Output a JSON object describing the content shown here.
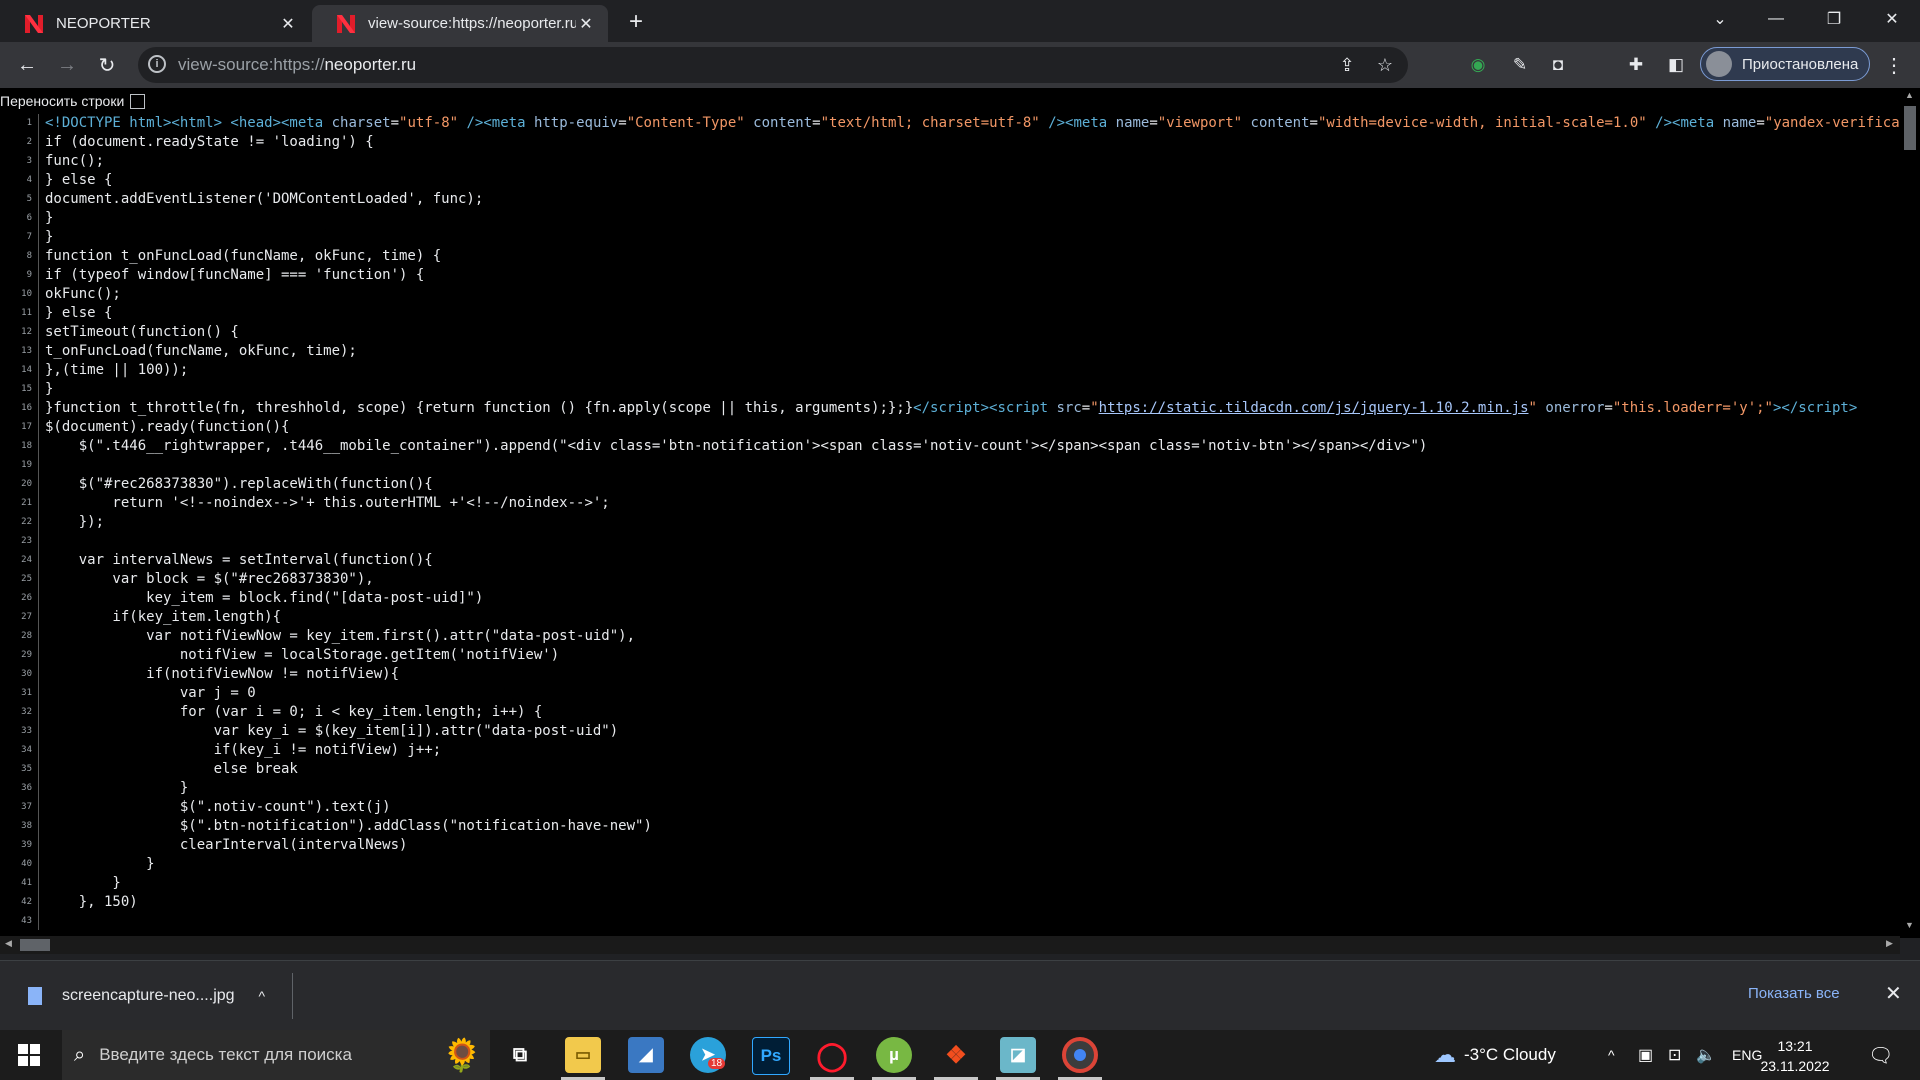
{
  "tabs": [
    {
      "title": "NEOPORTER",
      "active": false
    },
    {
      "title": "view-source:https://neoporter.ru",
      "active": true
    }
  ],
  "omnibox": {
    "url_prefix": "view-source:https://",
    "url_host": "neoporter.ru"
  },
  "profile": {
    "label": "Приостановлена"
  },
  "source": {
    "wrap_label": "Переносить строки",
    "lines": [
      {
        "n": "1",
        "html": "<span class='tg'>&lt;!DOCTYPE html&gt;&lt;html&gt; &lt;head&gt;&lt;meta</span> <span class='at'>charset</span>=<span class='av2'>\"utf-8\"</span> <span class='tg'>/&gt;&lt;meta</span> <span class='at'>http-equiv</span>=<span class='av2'>\"Content-Type\"</span> <span class='at'>content</span>=<span class='av2'>\"text/html; charset=utf-8\"</span> <span class='tg'>/&gt;&lt;meta</span> <span class='at'>name</span>=<span class='av2'>\"viewport\"</span> <span class='at'>content</span>=<span class='av2'>\"width=device-width, initial-scale=1.0\"</span> <span class='tg'>/&gt;&lt;meta</span> <span class='at'>name</span>=<span class='av2'>\"yandex-verification\"</span>"
      },
      {
        "n": "2",
        "html": "if (document.readyState != 'loading') {"
      },
      {
        "n": "3",
        "html": "func();"
      },
      {
        "n": "4",
        "html": "} else {"
      },
      {
        "n": "5",
        "html": "document.addEventListener('DOMContentLoaded', func);"
      },
      {
        "n": "6",
        "html": "}"
      },
      {
        "n": "7",
        "html": "}"
      },
      {
        "n": "8",
        "html": "function t_onFuncLoad(funcName, okFunc, time) {"
      },
      {
        "n": "9",
        "html": "if (typeof window[funcName] === 'function') {"
      },
      {
        "n": "10",
        "html": "okFunc();"
      },
      {
        "n": "11",
        "html": "} else {"
      },
      {
        "n": "12",
        "html": "setTimeout(function() {"
      },
      {
        "n": "13",
        "html": "t_onFuncLoad(funcName, okFunc, time);"
      },
      {
        "n": "14",
        "html": "},(time || 100));"
      },
      {
        "n": "15",
        "html": "}"
      },
      {
        "n": "16",
        "html": "}function t_throttle(fn, threshhold, scope) {return function () {fn.apply(scope || this, arguments);};}<span class='tg'>&lt;/script&gt;&lt;script</span> <span class='at'>src</span>=<span class='av2'>\"</span><span class='lk'>https://static.tildacdn.com/js/jquery-1.10.2.min.js</span><span class='av2'>\"</span> <span class='at'>onerror</span>=<span class='av2'>\"this.loaderr='y';\"</span><span class='tg'>&gt;&lt;/script&gt;</span>"
      },
      {
        "n": "17",
        "html": "$(document).ready(function(){"
      },
      {
        "n": "18",
        "html": "    $(\".t446__rightwrapper, .t446__mobile_container\").append(\"&lt;div class='btn-notification'&gt;&lt;span class='notiv-count'&gt;&lt;/span&gt;&lt;span class='notiv-btn'&gt;&lt;/span&gt;&lt;/div&gt;\")"
      },
      {
        "n": "19",
        "html": ""
      },
      {
        "n": "20",
        "html": "    $(\"#rec268373830\").replaceWith(function(){"
      },
      {
        "n": "21",
        "html": "        return '&lt;!--noindex--&gt;'+ this.outerHTML +'&lt;!--/noindex--&gt;';"
      },
      {
        "n": "22",
        "html": "    });"
      },
      {
        "n": "23",
        "html": ""
      },
      {
        "n": "24",
        "html": "    var intervalNews = setInterval(function(){"
      },
      {
        "n": "25",
        "html": "        var block = $(\"#rec268373830\"),"
      },
      {
        "n": "26",
        "html": "            key_item = block.find(\"[data-post-uid]\")"
      },
      {
        "n": "27",
        "html": "        if(key_item.length){"
      },
      {
        "n": "28",
        "html": "            var notifViewNow = key_item.first().attr(\"data-post-uid\"),"
      },
      {
        "n": "29",
        "html": "                notifView = localStorage.getItem('notifView')"
      },
      {
        "n": "30",
        "html": "            if(notifViewNow != notifView){"
      },
      {
        "n": "31",
        "html": "                var j = 0"
      },
      {
        "n": "32",
        "html": "                for (var i = 0; i &lt; key_item.length; i++) {"
      },
      {
        "n": "33",
        "html": "                    var key_i = $(key_item[i]).attr(\"data-post-uid\")"
      },
      {
        "n": "34",
        "html": "                    if(key_i != notifView) j++;"
      },
      {
        "n": "35",
        "html": "                    else break"
      },
      {
        "n": "36",
        "html": "                }"
      },
      {
        "n": "37",
        "html": "                $(\".notiv-count\").text(j)"
      },
      {
        "n": "38",
        "html": "                $(\".btn-notification\").addClass(\"notification-have-new\")"
      },
      {
        "n": "39",
        "html": "                clearInterval(intervalNews)"
      },
      {
        "n": "40",
        "html": "            }"
      },
      {
        "n": "41",
        "html": "        }"
      },
      {
        "n": "42",
        "html": "    }, 150)"
      },
      {
        "n": "43",
        "html": ""
      }
    ]
  },
  "downloads": {
    "file_name": "screencapture-neo....jpg",
    "show_all": "Показать все"
  },
  "taskbar": {
    "search_placeholder": "Введите здесь текст для поиска",
    "telegram_badge": "18",
    "weather": "-3°C  Cloudy",
    "lang": "ENG",
    "time": "13:21",
    "date": "23.11.2022"
  },
  "colors": {
    "tab_bg": "#202124",
    "toolbar_bg": "#35363a",
    "accent": "#8ab4f8",
    "source_bg": "#000000"
  }
}
